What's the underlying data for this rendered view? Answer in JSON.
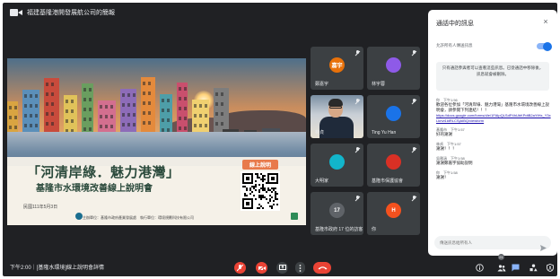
{
  "header": {
    "presenter_title": "福建基隆港開發展航公司的簡報"
  },
  "slide": {
    "title": "「河清岸綠．魅力港灣」",
    "subtitle": "基隆市水環境改善線上說明會",
    "date": "民國111年5月3日",
    "organizers": "主辦單位：基隆市政府產業發展處　執行單位：環境規劃科技有限公司",
    "qr_label": "線上說明"
  },
  "participants": [
    {
      "name": "鄭嘉宇",
      "initials": "嘉宇",
      "color": "#e8710a",
      "muted": true
    },
    {
      "name": "林宇蓉",
      "initials": "",
      "color": "#8e5ae8",
      "muted": true
    },
    {
      "name": "林貞",
      "initials": "",
      "color": "",
      "muted": true,
      "video": true
    },
    {
      "name": "Ting Yu Han",
      "initials": "",
      "color": "#1a73e8",
      "muted": true
    },
    {
      "name": "大明家",
      "initials": "",
      "color": "#12b5cb",
      "muted": true
    },
    {
      "name": "基隆市保護協會",
      "initials": "",
      "color": "#d93025",
      "muted": true
    },
    {
      "name": "基隆市政府 17 位的訪客",
      "initials": "17",
      "color": "#5f6368",
      "muted": true
    },
    {
      "name": "你",
      "initials": "H",
      "color": "#f4511e",
      "muted": true
    }
  ],
  "bottom": {
    "meeting_info": "下午2:00｜[基隆水環境]線上說明會詳情",
    "people_count": "21"
  },
  "chat": {
    "title": "通話中的訊息",
    "close": "×",
    "toggle_label": "允許所有人傳送訊息",
    "notice": "只有通話參與者可以查看這些訊息。已從通話中移除後，訊息就會被刪除。",
    "messages": [
      {
        "meta": "你　下午1:56",
        "text": "歡迎各位參加「河清岸綠．魅力港灣」基隆市水環境改善線上說明會，請參閱下列連結！！！",
        "link": "https://docs.google.com/forms/d/e/1FAIpQLSdP4hUbKPdtB2aYtHx_Y3xLknvt1ldRLCSjAIBQ/viewform"
      },
      {
        "meta": "基隆市　下午1:57",
        "text": "好的謝謝",
        "link": ""
      },
      {
        "meta": "林貞　下午1:57",
        "text": "謝謝！！！",
        "link": ""
      },
      {
        "meta": "吳雅涵　下午1:58",
        "text": "謝謝鄭嘉宇協助說明",
        "link": ""
      },
      {
        "meta": "你　下午1:58",
        "text": "謝謝！",
        "link": ""
      }
    ],
    "input_placeholder": "傳送訊息給所有人"
  }
}
